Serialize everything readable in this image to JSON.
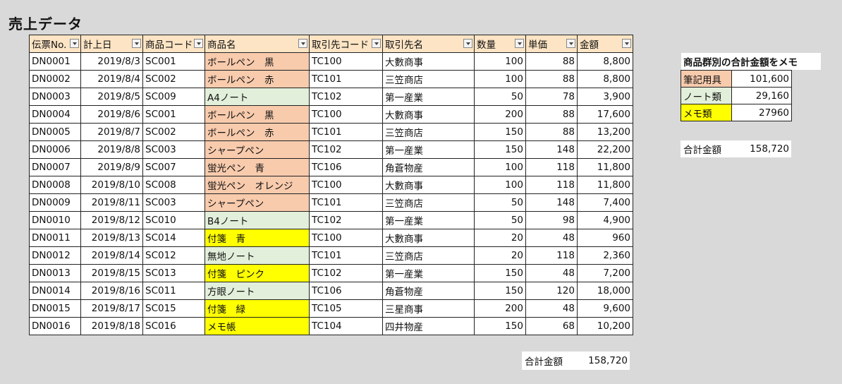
{
  "sheet_title": "売上データ",
  "headers": [
    "伝票No.",
    "計上日",
    "商品コード",
    "商品名",
    "取引先コード",
    "取引先名",
    "数量",
    "単価",
    "金額"
  ],
  "rows": [
    [
      "DN0001",
      "2019/8/3",
      "SC001",
      "ボールペン　黒",
      "TC100",
      "大數商事",
      "100",
      "88",
      "8,800",
      "pen"
    ],
    [
      "DN0002",
      "2019/8/4",
      "SC002",
      "ボールペン　赤",
      "TC101",
      "三笠商店",
      "100",
      "88",
      "8,800",
      "pen"
    ],
    [
      "DN0003",
      "2019/8/5",
      "SC009",
      "A4ノート",
      "TC102",
      "第一産業",
      "50",
      "78",
      "3,900",
      "note"
    ],
    [
      "DN0004",
      "2019/8/6",
      "SC001",
      "ボールペン　黒",
      "TC100",
      "大數商事",
      "200",
      "88",
      "17,600",
      "pen"
    ],
    [
      "DN0005",
      "2019/8/7",
      "SC002",
      "ボールペン　赤",
      "TC101",
      "三笠商店",
      "150",
      "88",
      "13,200",
      "pen"
    ],
    [
      "DN0006",
      "2019/8/8",
      "SC003",
      "シャープペン",
      "TC102",
      "第一産業",
      "150",
      "148",
      "22,200",
      "pen"
    ],
    [
      "DN0007",
      "2019/8/9",
      "SC007",
      "蛍光ペン　青",
      "TC106",
      "角蒼物産",
      "100",
      "118",
      "11,800",
      "pen"
    ],
    [
      "DN0008",
      "2019/8/10",
      "SC008",
      "蛍光ペン　オレンジ",
      "TC100",
      "大數商事",
      "100",
      "118",
      "11,800",
      "pen"
    ],
    [
      "DN0009",
      "2019/8/11",
      "SC003",
      "シャープペン",
      "TC101",
      "三笠商店",
      "50",
      "148",
      "7,400",
      "pen"
    ],
    [
      "DN0010",
      "2019/8/12",
      "SC010",
      "B4ノート",
      "TC102",
      "第一産業",
      "50",
      "98",
      "4,900",
      "note"
    ],
    [
      "DN0011",
      "2019/8/13",
      "SC014",
      "付箋　青",
      "TC100",
      "大數商事",
      "20",
      "48",
      "960",
      "memo"
    ],
    [
      "DN0012",
      "2019/8/14",
      "SC012",
      "無地ノート",
      "TC101",
      "三笠商店",
      "20",
      "118",
      "2,360",
      "note"
    ],
    [
      "DN0013",
      "2019/8/15",
      "SC013",
      "付箋　ピンク",
      "TC102",
      "第一産業",
      "150",
      "48",
      "7,200",
      "memo"
    ],
    [
      "DN0014",
      "2019/8/16",
      "SC011",
      "方眼ノート",
      "TC106",
      "角蒼物産",
      "150",
      "120",
      "18,000",
      "note"
    ],
    [
      "DN0015",
      "2019/8/17",
      "SC015",
      "付箋　緑",
      "TC105",
      "三星商事",
      "200",
      "48",
      "9,600",
      "memo"
    ],
    [
      "DN0016",
      "2019/8/18",
      "SC016",
      "メモ帳",
      "TC104",
      "四井物産",
      "150",
      "68",
      "10,200",
      "memo"
    ]
  ],
  "total": {
    "label": "合計金額",
    "value": "158,720"
  },
  "memo": {
    "title": "商品群別の合計金額をメモ",
    "rows": [
      {
        "category": "筆記用具",
        "value": "101,600",
        "color": "pen"
      },
      {
        "category": "ノート類",
        "value": "29,160",
        "color": "note"
      },
      {
        "category": "メモ類",
        "value": "27960",
        "color": "memo"
      }
    ],
    "total_label": "合計金額",
    "total_value": "158,720"
  },
  "colors": {
    "pen": "#f8cbad",
    "note": "#e2efda",
    "memo": "#ffff00",
    "header": "#fce4c4"
  }
}
